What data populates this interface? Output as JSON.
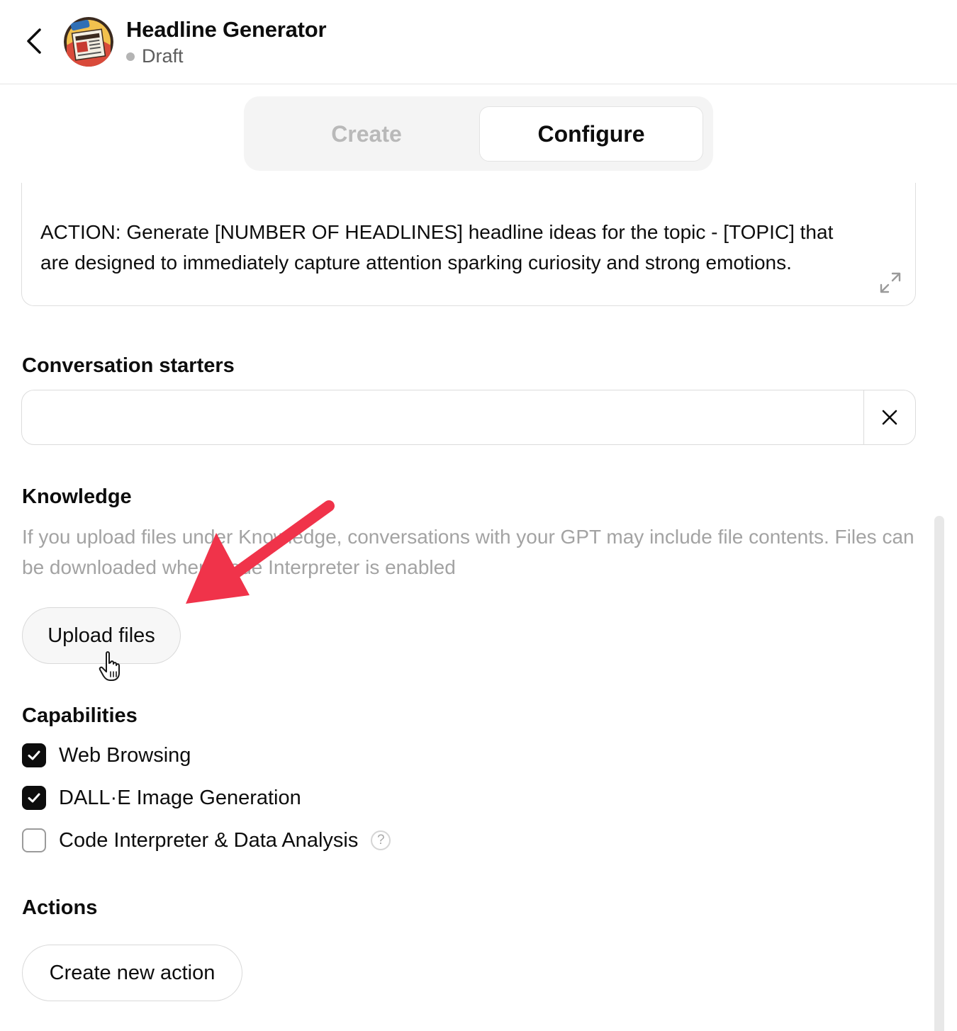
{
  "header": {
    "back_icon": "chevron-left-icon",
    "avatar_icon": "newspaper-avatar",
    "title": "Headline Generator",
    "status": "Draft"
  },
  "tabs": [
    {
      "label": "Create",
      "active": false
    },
    {
      "label": "Configure",
      "active": true
    }
  ],
  "instructions": {
    "text": "ACTION: Generate [NUMBER OF HEADLINES] headline ideas for the topic - [TOPIC] that are designed to immediately capture attention sparking curiosity and strong emotions.",
    "expand_icon": "expand-icon"
  },
  "conversation_starters": {
    "title": "Conversation starters",
    "value": "",
    "clear_icon": "close-icon"
  },
  "knowledge": {
    "title": "Knowledge",
    "description": "If you upload files under Knowledge, conversations with your GPT may include file contents. Files can be downloaded when Code Interpreter is enabled",
    "upload_label": "Upload files"
  },
  "capabilities": {
    "title": "Capabilities",
    "items": [
      {
        "label": "Web Browsing",
        "checked": true
      },
      {
        "label": "DALL·E Image Generation",
        "checked": true
      },
      {
        "label": "Code Interpreter & Data Analysis",
        "checked": false,
        "help": "?"
      }
    ]
  },
  "actions": {
    "title": "Actions",
    "create_label": "Create new action"
  },
  "colors": {
    "annotation_arrow": "#f0334a",
    "text": "#0d0d0d",
    "muted": "#a3a3a3"
  }
}
